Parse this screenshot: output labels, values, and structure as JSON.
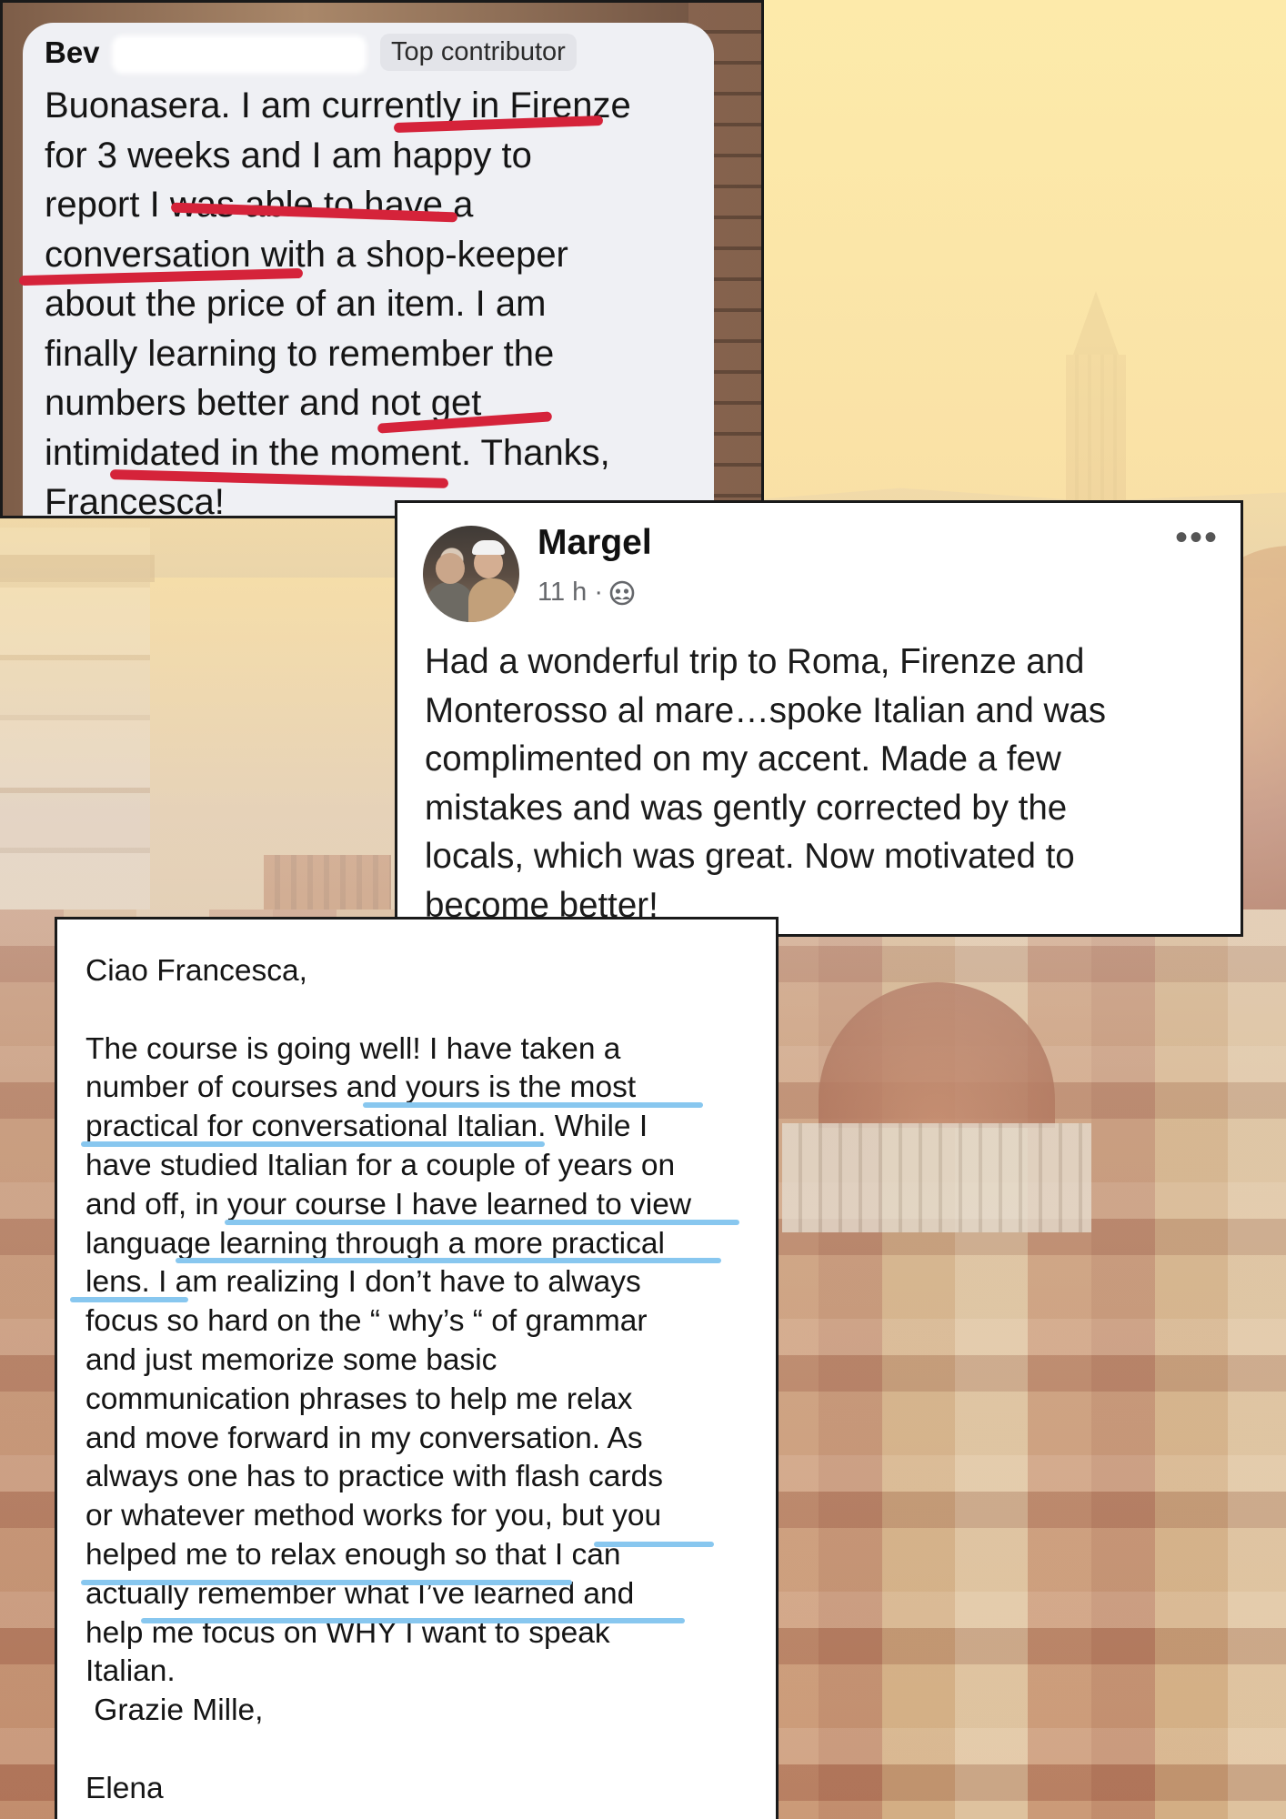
{
  "bev_post": {
    "author": "Bev",
    "badge": "Top contributor",
    "lines": [
      "Buonasera. I am currently in Firenze",
      "for 3 weeks and I am happy to",
      "report I was able to have a",
      "conversation with a shop-keeper",
      "about the price of an item. I am",
      "finally learning to remember the",
      "numbers better and not get",
      "intimidated in the moment. Thanks,",
      "Francesca!"
    ],
    "highlight_color": "#d5233a"
  },
  "margel_post": {
    "author": "Margel",
    "time": "11 h ·",
    "audience_icon": "friends-icon",
    "menu_icon": "more-dots-icon",
    "menu_label": "•••",
    "lines": [
      "Had a wonderful trip to Roma, Firenze and",
      "Monterosso al mare…spoke Italian and was",
      "complimented on my accent. Made a few",
      "mistakes and was gently corrected by the",
      "locals, which was great. Now motivated to",
      "become better!"
    ]
  },
  "elena_letter": {
    "lines": [
      "Ciao Francesca,",
      "",
      "The course is going well! I have taken a",
      "number of courses and yours is the most",
      "practical for conversational Italian. While  I",
      "have studied  Italian for a couple of years on",
      "and off, in your course I have learned to view",
      "language learning through a more practical",
      "lens. I am realizing I don’t have to always",
      "focus so hard on the “ why’s “ of grammar",
      "and just memorize some basic",
      "communication  phrases to help me relax",
      "and move forward in my conversation.  As",
      "always one has to practice with flash cards",
      "or whatever method works for you, but you",
      "helped me to relax enough so that I can",
      "actually remember what I’ve learned and",
      "help me focus on WHY I want to speak",
      "Italian.",
      " Grazie Mille,",
      "",
      "Elena"
    ],
    "highlight_color": "#88c7ef"
  }
}
